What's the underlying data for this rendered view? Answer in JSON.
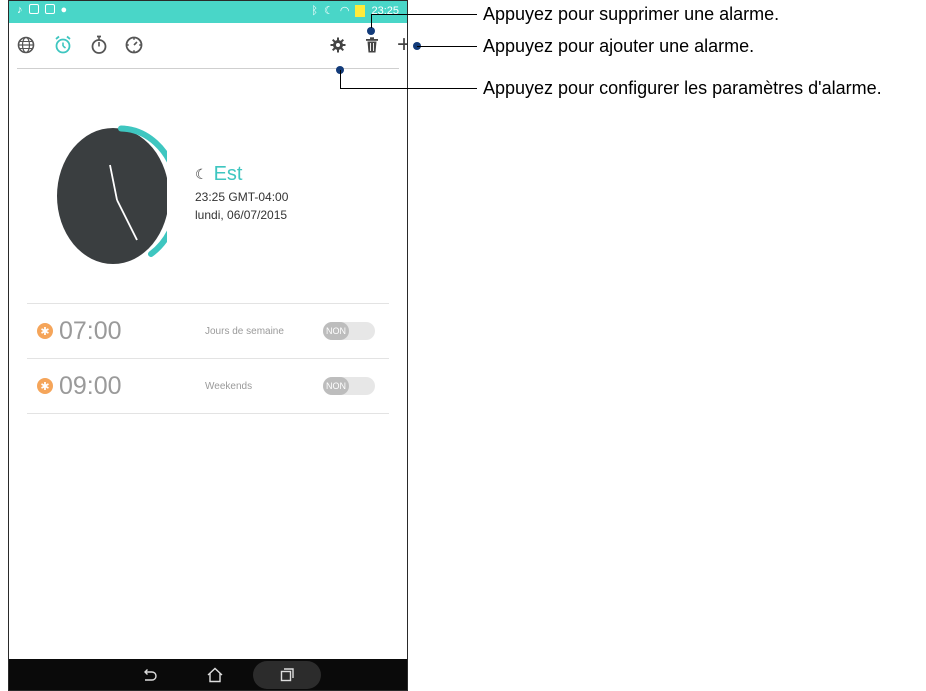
{
  "status_bar": {
    "left_icons": [
      "music-icon",
      "photo-icon",
      "gallery-icon",
      "location-icon"
    ],
    "right_icons": [
      "bluetooth-icon",
      "moon-icon",
      "wifi-icon",
      "battery-icon"
    ],
    "time": "23:25",
    "bg_color": "#49d6c8"
  },
  "toolbar": {
    "tabs": [
      "world-clock-tab",
      "alarm-tab",
      "stopwatch-tab",
      "timer-tab"
    ],
    "active_tab": "alarm-tab",
    "actions": [
      "settings-button",
      "delete-button",
      "add-button"
    ],
    "add_symbol": "+"
  },
  "clock": {
    "tz_name": "Est",
    "time_offset": "23:25   GMT-04:00",
    "date": "lundi, 06/07/2015",
    "accent_color": "#3ec6c0"
  },
  "alarms": [
    {
      "time": "07:00",
      "label": "Jours de semaine",
      "toggle": "NON"
    },
    {
      "time": "09:00",
      "label": "Weekends",
      "toggle": "NON"
    }
  ],
  "callouts": {
    "delete": "Appuyez pour supprimer une alarme.",
    "add": "Appuyez pour ajouter une alarme.",
    "settings": "Appuyez pour configurer les paramètres d'alarme."
  }
}
